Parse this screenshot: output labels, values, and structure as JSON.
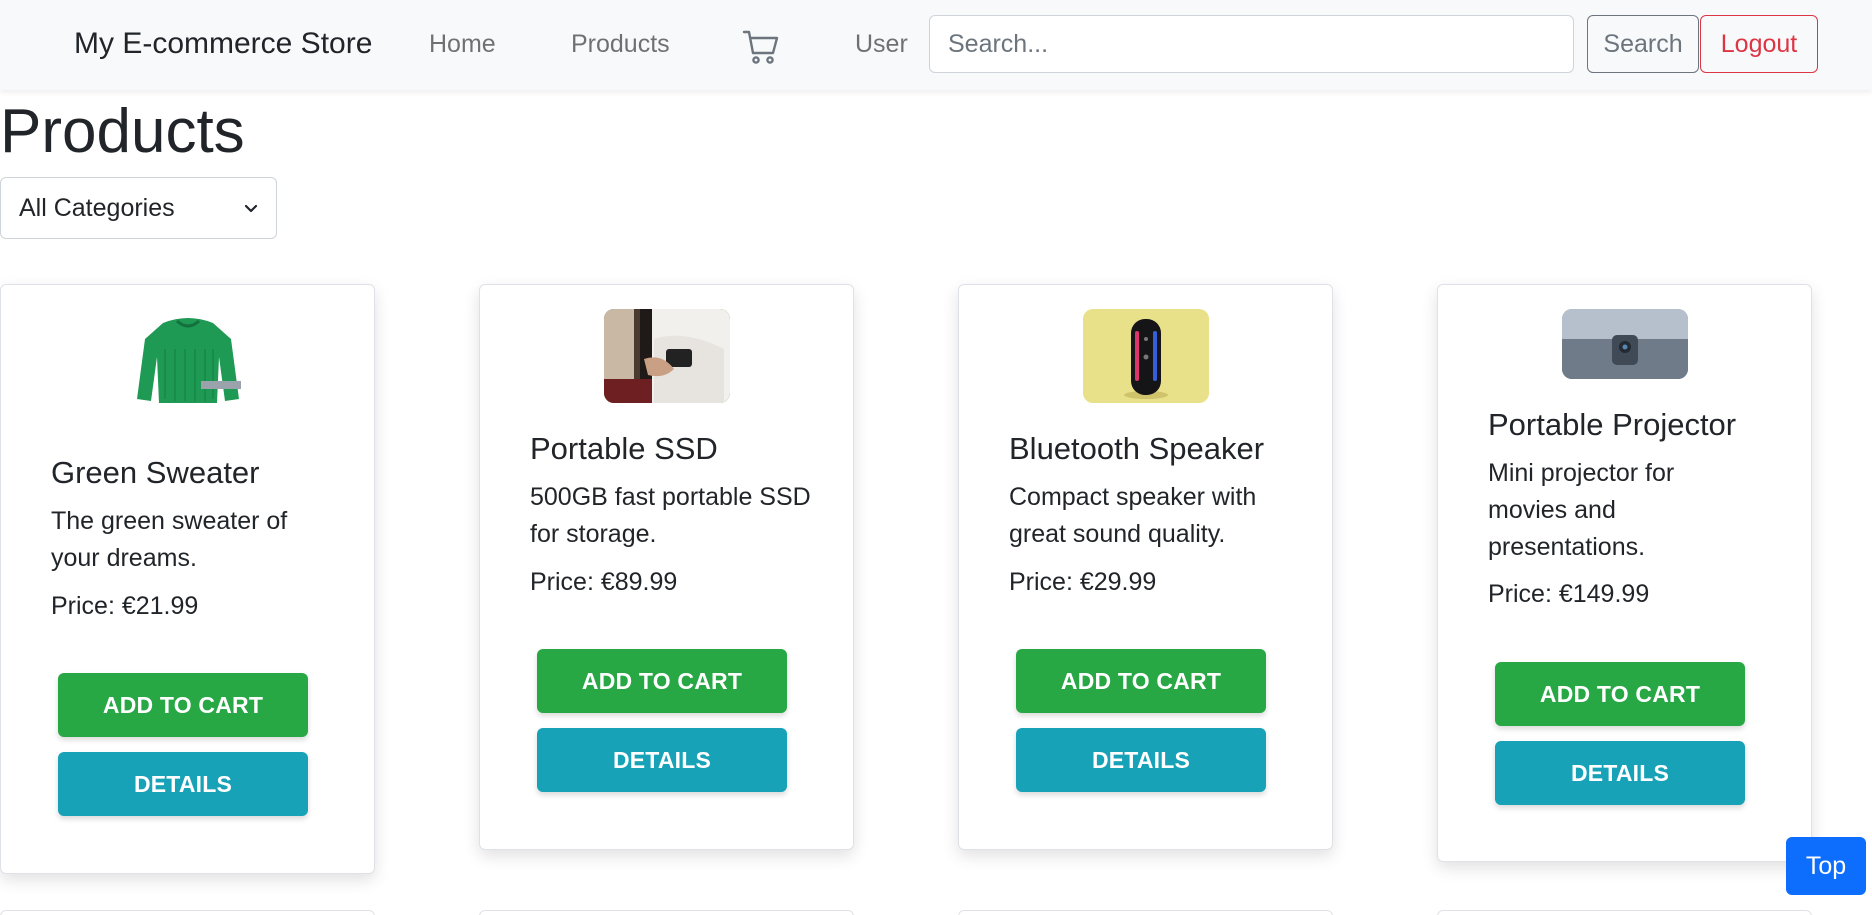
{
  "navbar": {
    "brand": "My E-commerce Store",
    "home": "Home",
    "products": "Products",
    "cart_icon": "cart-icon",
    "user": "User",
    "search_placeholder": "Search...",
    "search_button": "Search",
    "logout_button": "Logout"
  },
  "page": {
    "title": "Products",
    "category_selected": "All Categories"
  },
  "products": [
    {
      "name": "Green Sweater",
      "description": "The green sweater of your dreams.",
      "price": "Price: €21.99",
      "image": "green-sweater-image",
      "add_to_cart": "ADD TO CART",
      "details": "DETAILS"
    },
    {
      "name": "Portable SSD",
      "description": "500GB fast portable SSD for storage.",
      "price": "Price: €89.99",
      "image": "portable-ssd-image",
      "add_to_cart": "ADD TO CART",
      "details": "DETAILS"
    },
    {
      "name": "Bluetooth Speaker",
      "description": "Compact speaker with great sound quality.",
      "price": "Price: €29.99",
      "image": "bluetooth-speaker-image",
      "add_to_cart": "ADD TO CART",
      "details": "DETAILS"
    },
    {
      "name": "Portable Projector",
      "description": "Mini projector for movies and presentations.",
      "price": "Price: €149.99",
      "image": "portable-projector-image",
      "add_to_cart": "ADD TO CART",
      "details": "DETAILS"
    }
  ],
  "top_button": "Top",
  "colors": {
    "add_to_cart": "#28a745",
    "details": "#17a2b8",
    "logout": "#dc3545",
    "top": "#0d6efd"
  }
}
